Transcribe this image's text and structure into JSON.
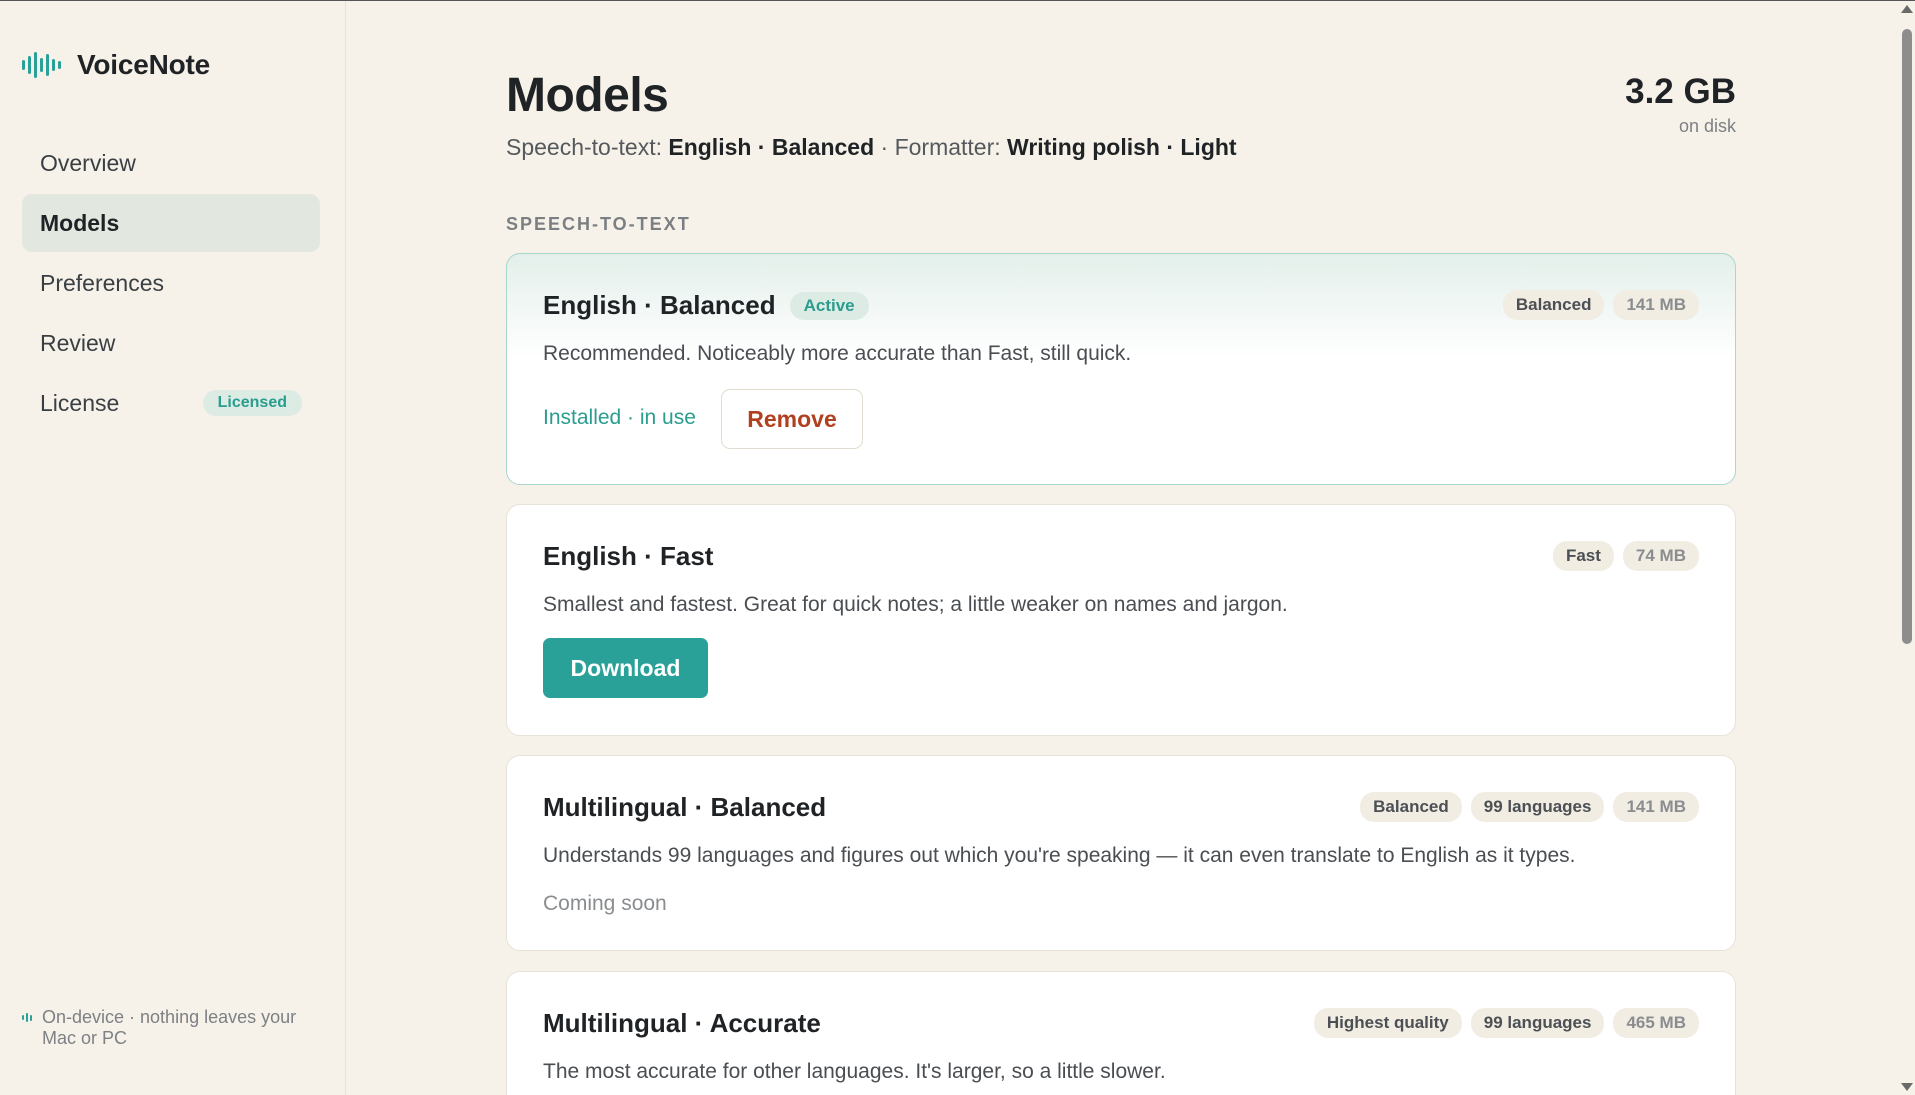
{
  "app": {
    "name": "VoiceNote"
  },
  "sidebar": {
    "items": [
      {
        "label": "Overview"
      },
      {
        "label": "Models",
        "active": true
      },
      {
        "label": "Preferences"
      },
      {
        "label": "Review"
      },
      {
        "label": "License",
        "badge": "Licensed"
      }
    ],
    "footer": "On-device · nothing leaves your Mac or PC"
  },
  "header": {
    "title": "Models",
    "subtitle": {
      "stt_label": "Speech-to-text:",
      "stt_value": "English · Balanced",
      "separator": "·",
      "formatter_label": "Formatter:",
      "formatter_value": "Writing polish · Light"
    },
    "disk_size": "3.2 GB",
    "disk_label": "on disk"
  },
  "section": {
    "label": "SPEECH-TO-TEXT"
  },
  "models": [
    {
      "name": "English · Balanced",
      "badge": "Active",
      "tags": [
        "Balanced"
      ],
      "size": "141 MB",
      "description": "Recommended. Noticeably more accurate than Fast, still quick.",
      "status": "Installed · in use",
      "action": "Remove"
    },
    {
      "name": "English · Fast",
      "tags": [
        "Fast"
      ],
      "size": "74 MB",
      "description": "Smallest and fastest. Great for quick notes; a little weaker on names and jargon.",
      "action": "Download"
    },
    {
      "name": "Multilingual · Balanced",
      "tags": [
        "Balanced",
        "99 languages"
      ],
      "size": "141 MB",
      "description": "Understands 99 languages and figures out which you're speaking — it can even translate to English as it types.",
      "status": "Coming soon"
    },
    {
      "name": "Multilingual · Accurate",
      "tags": [
        "Highest quality",
        "99 languages"
      ],
      "size": "465 MB",
      "description": "The most accurate for other languages. It's larger, so a little slower."
    }
  ],
  "colors": {
    "accent": "#2aa198",
    "danger": "#b0401f",
    "background": "#f6f2e9"
  }
}
